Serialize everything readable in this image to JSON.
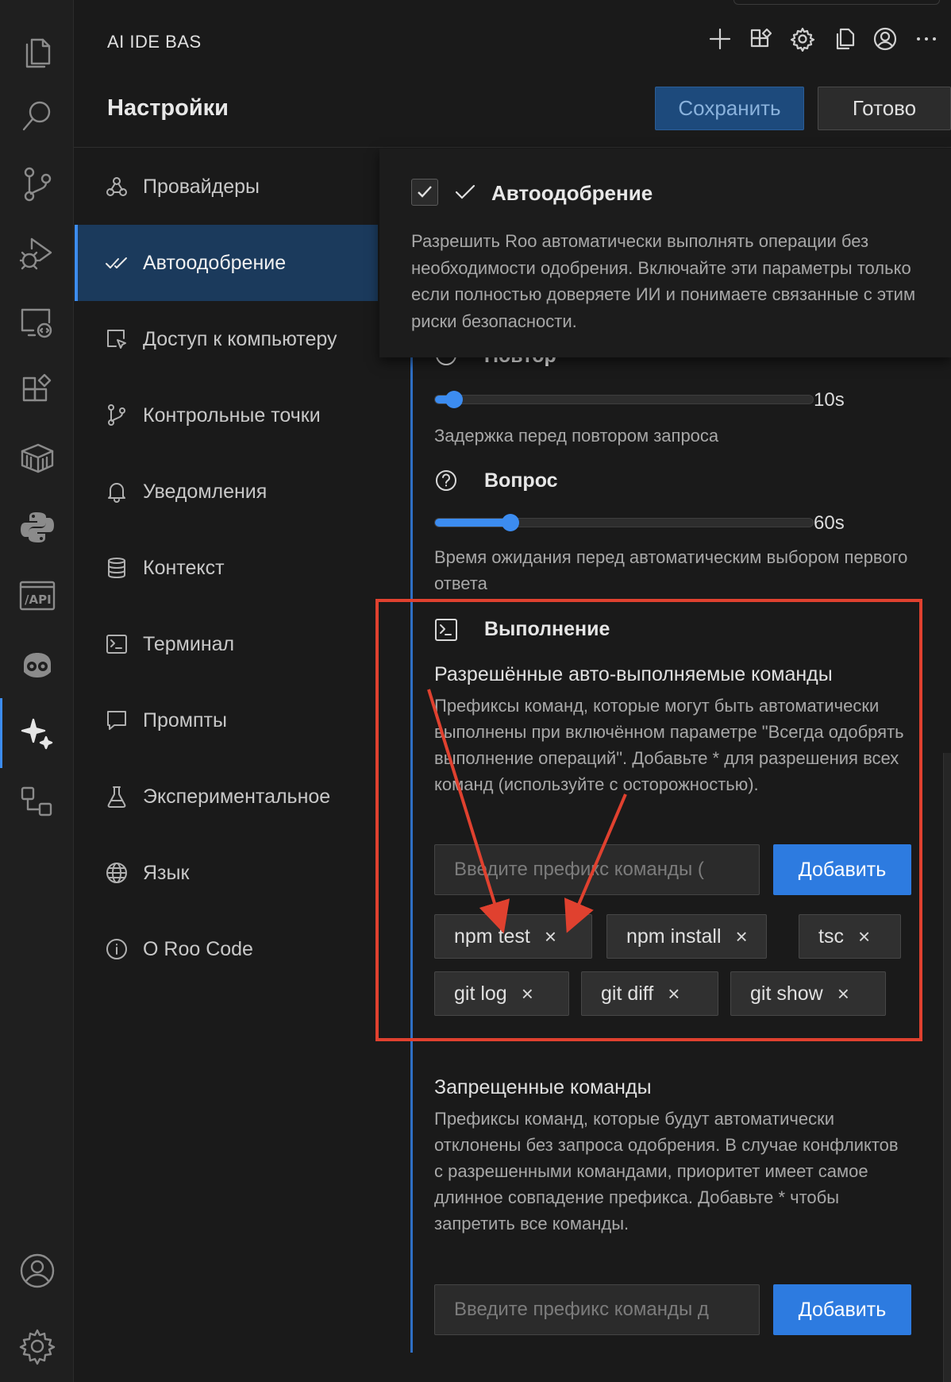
{
  "app": {
    "title": "AI IDE BAS"
  },
  "toolbar": {
    "icons": [
      "plus-icon",
      "extensions-icon",
      "gear-icon",
      "copy-icon",
      "account-icon",
      "more-icon"
    ]
  },
  "header": {
    "title": "Настройки",
    "save_label": "Сохранить",
    "done_label": "Готово"
  },
  "activity_bar": {
    "icons": [
      "files-icon",
      "search-icon",
      "source-control-icon",
      "run-debug-icon",
      "remote-explorer-icon",
      "extensions-icon",
      "package-icon",
      "python-icon",
      "api-icon",
      "copilot-icon",
      "roo-sparkle-icon",
      "diagram-icon",
      "account-icon",
      "settings-gear-icon"
    ],
    "api_label": "/API"
  },
  "sidebar": {
    "items": [
      {
        "label": "Провайдеры",
        "icon": "webhook-icon"
      },
      {
        "label": "Автоодобрение",
        "icon": "check-all-icon",
        "active": true
      },
      {
        "label": "Доступ к компьютеру",
        "icon": "cursor-select-icon"
      },
      {
        "label": "Контрольные точки",
        "icon": "git-branch-icon"
      },
      {
        "label": "Уведомления",
        "icon": "bell-icon"
      },
      {
        "label": "Контекст",
        "icon": "database-icon"
      },
      {
        "label": "Терминал",
        "icon": "terminal-icon"
      },
      {
        "label": "Промпты",
        "icon": "message-icon"
      },
      {
        "label": "Экспериментальное",
        "icon": "flask-icon"
      },
      {
        "label": "Язык",
        "icon": "globe-icon"
      },
      {
        "label": "О Roo Code",
        "icon": "info-icon"
      }
    ]
  },
  "popup": {
    "checked": true,
    "title": "Автоодобрение",
    "description": "Разрешить Roo автоматически выполнять операции без необходимости одобрения. Включайте эти параметры только если полностью доверяете ИИ и понимаете связанные с этим риски безопасности."
  },
  "retry": {
    "title": "Повтор",
    "value_label": "10s",
    "level_fraction": 0.05,
    "description": "Задержка перед повтором запроса"
  },
  "question": {
    "title": "Вопрос",
    "value_label": "60s",
    "level_fraction": 0.2,
    "description": "Время ожидания перед автоматическим выбором первого ответа"
  },
  "execution": {
    "title": "Выполнение",
    "allowed": {
      "title": "Разрешённые авто-выполняемые команды",
      "description": "Префиксы команд, которые могут быть автоматически выполнены при включённом параметре \"Всегда одобрять выполнение операций\". Добавьте * для разрешения всех команд (используйте с осторожностью).",
      "placeholder": "Введите префикс команды (",
      "add_label": "Добавить",
      "commands": [
        "npm test",
        "npm install",
        "tsc",
        "git log",
        "git diff",
        "git show"
      ],
      "remove_glyph": "×"
    },
    "denied": {
      "title": "Запрещенные команды",
      "description": "Префиксы команд, которые будут автоматически отклонены без запроса одобрения. В случае конфликтов с разрешенными командами, приоритет имеет самое длинное совпадение префикса. Добавьте * чтобы запретить все команды.",
      "placeholder": "Введите префикс команды д",
      "add_label": "Добавить"
    }
  },
  "colors": {
    "accent": "#3c8cf0",
    "annotation": "#e0412f",
    "active_nav": "#1b3a5c"
  }
}
